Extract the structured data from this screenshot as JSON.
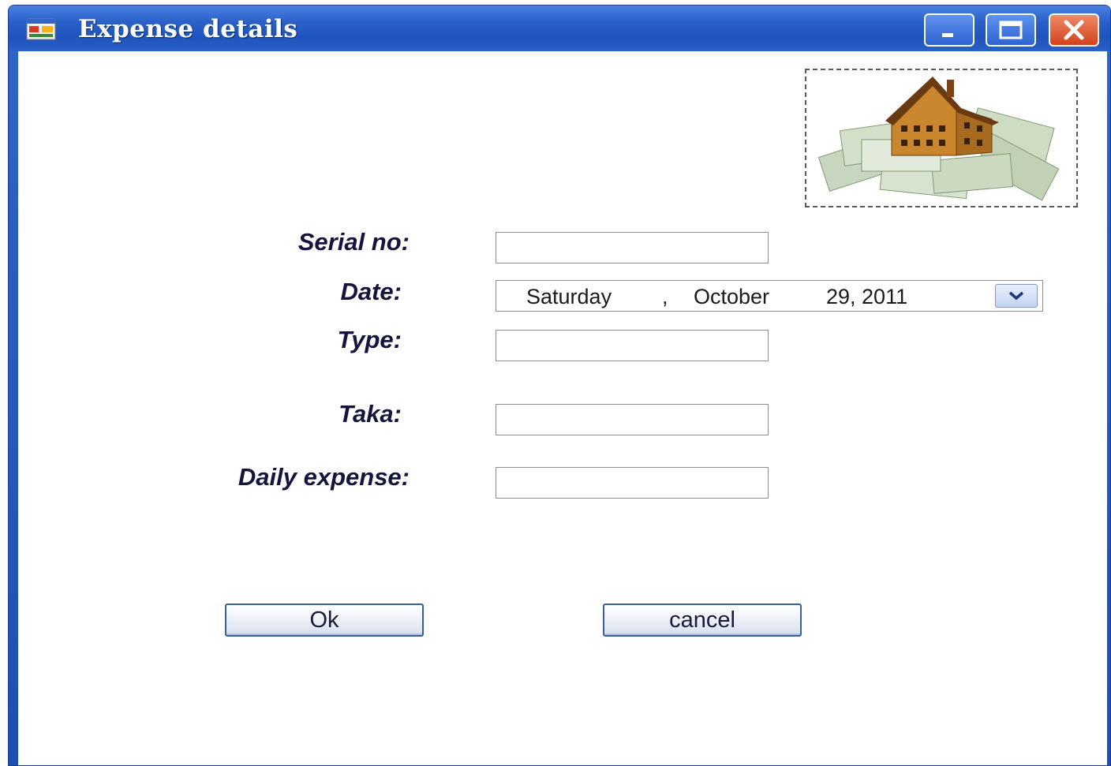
{
  "window": {
    "title": "Expense details"
  },
  "form": {
    "serial_label": "Serial no:",
    "serial_value": "",
    "date_label": "Date:",
    "date": {
      "weekday": "Saturday",
      "separator": ",",
      "month": "October",
      "day_year": "29, 2011"
    },
    "type_label": "Type:",
    "type_value": "",
    "taka_label": "Taka:",
    "taka_value": "",
    "daily_label": "Daily expense:",
    "daily_value": ""
  },
  "buttons": {
    "ok_label": "Ok",
    "cancel_label": "cancel"
  },
  "icons": {
    "app": "app-window-icon",
    "picture": "house-on-money-image",
    "dropdown": "chevron-down-icon"
  }
}
